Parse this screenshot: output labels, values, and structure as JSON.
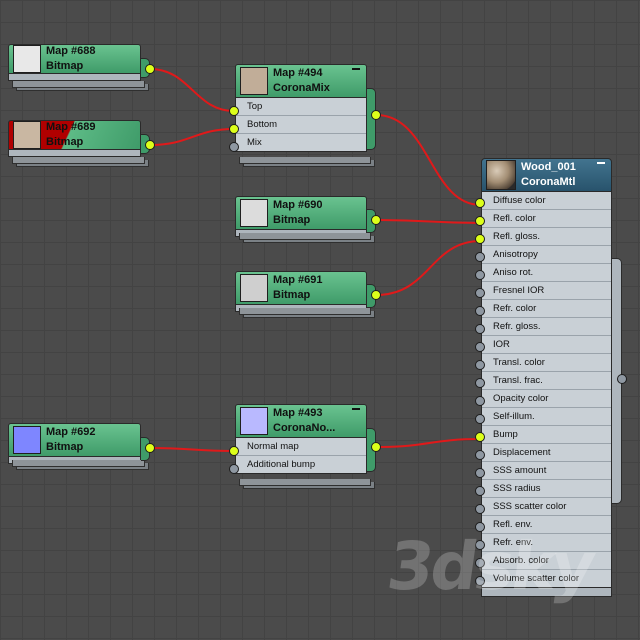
{
  "nodes": {
    "map688": {
      "name": "Map #688",
      "type": "Bitmap",
      "thumb_color": "#e8e8e8"
    },
    "map689": {
      "name": "Map #689",
      "type": "Bitmap",
      "thumb_color": "#c9b7a2",
      "error_color": "#b00000"
    },
    "map494": {
      "name": "Map #494",
      "type": "CoronaMix",
      "thumb_color": "#c1ad98",
      "slots": [
        "Top",
        "Bottom",
        "Mix"
      ]
    },
    "map690": {
      "name": "Map #690",
      "type": "Bitmap",
      "thumb_color": "#dcdcdc"
    },
    "map691": {
      "name": "Map #691",
      "type": "Bitmap",
      "thumb_color": "#cfcfcf"
    },
    "map692": {
      "name": "Map #692",
      "type": "Bitmap",
      "thumb_color": "#7e86ff"
    },
    "map493": {
      "name": "Map #493",
      "type": "CoronaNo...",
      "thumb_color": "#b9b9ff",
      "slots": [
        "Normal map",
        "Additional bump"
      ]
    },
    "wood": {
      "name": "Wood_001",
      "type": "CoronaMtl",
      "slots": [
        "Diffuse color",
        "Refl. color",
        "Refl. gloss.",
        "Anisotropy",
        "Aniso rot.",
        "Fresnel IOR",
        "Refr. color",
        "Refr. gloss.",
        "IOR",
        "Transl. color",
        "Transl. frac.",
        "Opacity color",
        "Self-illum.",
        "Bump",
        "Displacement",
        "SSS amount",
        "SSS radius",
        "SSS scatter color",
        "Refl. env.",
        "Refr. env.",
        "Absorb. color",
        "Volume scatter color"
      ]
    }
  },
  "watermark": "3dsky",
  "colors": {
    "wire": "#e0191a",
    "socket_connected": "#ddff1a",
    "socket_empty": "#8f98a2",
    "node_header": "#4fae79",
    "material_header": "#35627c"
  }
}
